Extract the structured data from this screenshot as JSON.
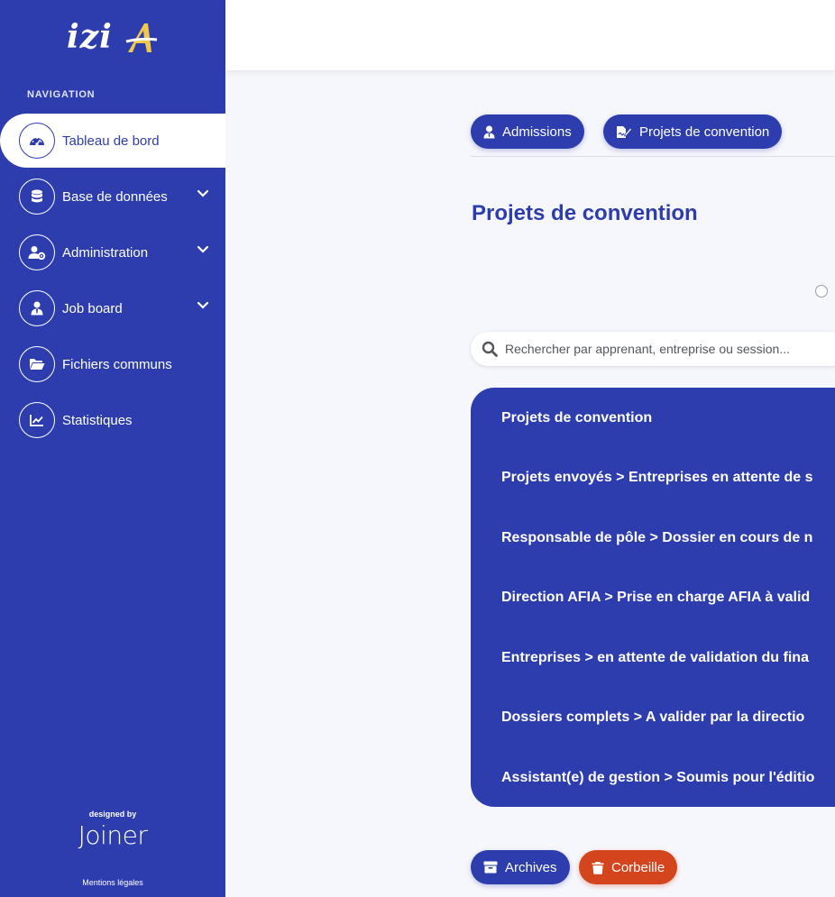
{
  "sidebar": {
    "logo_text": "izi",
    "nav_heading": "NAVIGATION",
    "items": [
      {
        "label": "Tableau de bord",
        "icon": "dashboard-icon",
        "active": true
      },
      {
        "label": "Base de données",
        "icon": "database-icon",
        "expandable": true
      },
      {
        "label": "Administration",
        "icon": "user-gear-icon",
        "expandable": true
      },
      {
        "label": "Job board",
        "icon": "user-tie-icon",
        "expandable": true
      },
      {
        "label": "Fichiers communs",
        "icon": "folder-open-icon"
      },
      {
        "label": "Statistiques",
        "icon": "chart-line-icon"
      }
    ],
    "designed_by": "designed by",
    "brand": "Joiner",
    "mentions": "Mentions légales"
  },
  "tabs": [
    {
      "label": "Admissions",
      "icon": "user-icon"
    },
    {
      "label": "Projets de convention",
      "icon": "file-signature-icon"
    }
  ],
  "page_title": "Projets de convention",
  "search": {
    "placeholder": "Rechercher par apprenant, entreprise ou session..."
  },
  "status_rows": [
    "Projets de convention",
    "Projets envoyés > Entreprises en attente de s",
    "Responsable de pôle > Dossier en cours de n",
    "Direction AFIA > Prise en charge AFIA à valid",
    "Entreprises > en attente de validation du fina",
    "Dossiers complets > A valider par la directio",
    "Assistant(e) de gestion > Soumis pour l'éditio"
  ],
  "footer_buttons": {
    "archives": "Archives",
    "corbeille": "Corbeille"
  },
  "colors": {
    "primary": "#2e3dae",
    "danger": "#d4451e",
    "logo_accent": "#f2c84b",
    "background": "#f6f7fc"
  }
}
